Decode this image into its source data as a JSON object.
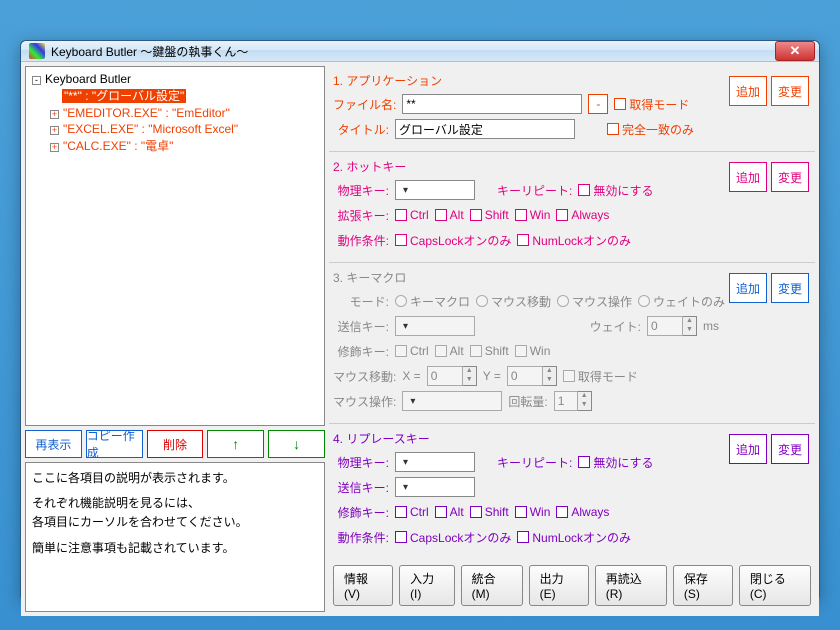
{
  "window": {
    "title": "Keyboard Butler ～鍵盤の執事くん～"
  },
  "tree": {
    "root": "Keyboard Butler",
    "items": [
      {
        "text": "\"**\" : \"グローバル設定\"",
        "selected": true,
        "expandable": false
      },
      {
        "text": "\"EMEDITOR.EXE\" : \"EmEditor\"",
        "selected": false,
        "expandable": true
      },
      {
        "text": "\"EXCEL.EXE\" : \"Microsoft Excel\"",
        "selected": false,
        "expandable": true
      },
      {
        "text": "\"CALC.EXE\" : \"電卓\"",
        "selected": false,
        "expandable": true
      }
    ]
  },
  "left_buttons": {
    "redisplay": "再表示",
    "copy": "コピー作成",
    "delete": "削除",
    "up": "↑",
    "down": "↓"
  },
  "help": {
    "line1": "ここに各項目の説明が表示されます。",
    "line2": "それぞれ機能説明を見るには、",
    "line3": "各項目にカーソルを合わせてください。",
    "line4": "簡単に注意事項も記載されています。"
  },
  "sec1": {
    "title": "1. アプリケーション",
    "filename_lbl": "ファイル名:",
    "filename_val": "**",
    "title_lbl": "タイトル:",
    "title_val": "グローバル設定",
    "minus": "-",
    "acquire_mode": "取得モード",
    "exact_match": "完全一致のみ",
    "add": "追加",
    "change": "変更"
  },
  "sec2": {
    "title": "2. ホットキー",
    "phys_lbl": "物理キー:",
    "repeat_lbl": "キーリピート:",
    "disable": "無効にする",
    "ext_lbl": "拡張キー:",
    "Ctrl": "Ctrl",
    "Alt": "Alt",
    "Shift": "Shift",
    "Win": "Win",
    "Always": "Always",
    "cond_lbl": "動作条件:",
    "caps": "CapsLockオンのみ",
    "num": "NumLockオンのみ",
    "add": "追加",
    "change": "変更"
  },
  "sec3": {
    "title": "3. キーマクロ",
    "mode_lbl": "モード:",
    "m1": "キーマクロ",
    "m2": "マウス移動",
    "m3": "マウス操作",
    "m4": "ウェイトのみ",
    "send_lbl": "送信キー:",
    "wait_lbl": "ウェイト:",
    "wait_val": "0",
    "ms": "ms",
    "mod_lbl": "修飾キー:",
    "Ctrl": "Ctrl",
    "Alt": "Alt",
    "Shift": "Shift",
    "Win": "Win",
    "move_lbl": "マウス移動:",
    "x": "X =",
    "xval": "0",
    "y": "Y =",
    "yval": "0",
    "acquire": "取得モード",
    "op_lbl": "マウス操作:",
    "rot_lbl": "回転量:",
    "rot_val": "1",
    "add": "追加",
    "change": "変更"
  },
  "sec4": {
    "title": "4. リプレースキー",
    "phys_lbl": "物理キー:",
    "repeat_lbl": "キーリピート:",
    "disable": "無効にする",
    "send_lbl": "送信キー:",
    "mod_lbl": "修飾キー:",
    "Ctrl": "Ctrl",
    "Alt": "Alt",
    "Shift": "Shift",
    "Win": "Win",
    "Always": "Always",
    "cond_lbl": "動作条件:",
    "caps": "CapsLockオンのみ",
    "num": "NumLockオンのみ",
    "add": "追加",
    "change": "変更"
  },
  "bottom": {
    "info": "情報(V)",
    "input": "入力(I)",
    "merge": "統合(M)",
    "output": "出力(E)",
    "reload": "再読込(R)",
    "save": "保存(S)",
    "close": "閉じる(C)"
  }
}
